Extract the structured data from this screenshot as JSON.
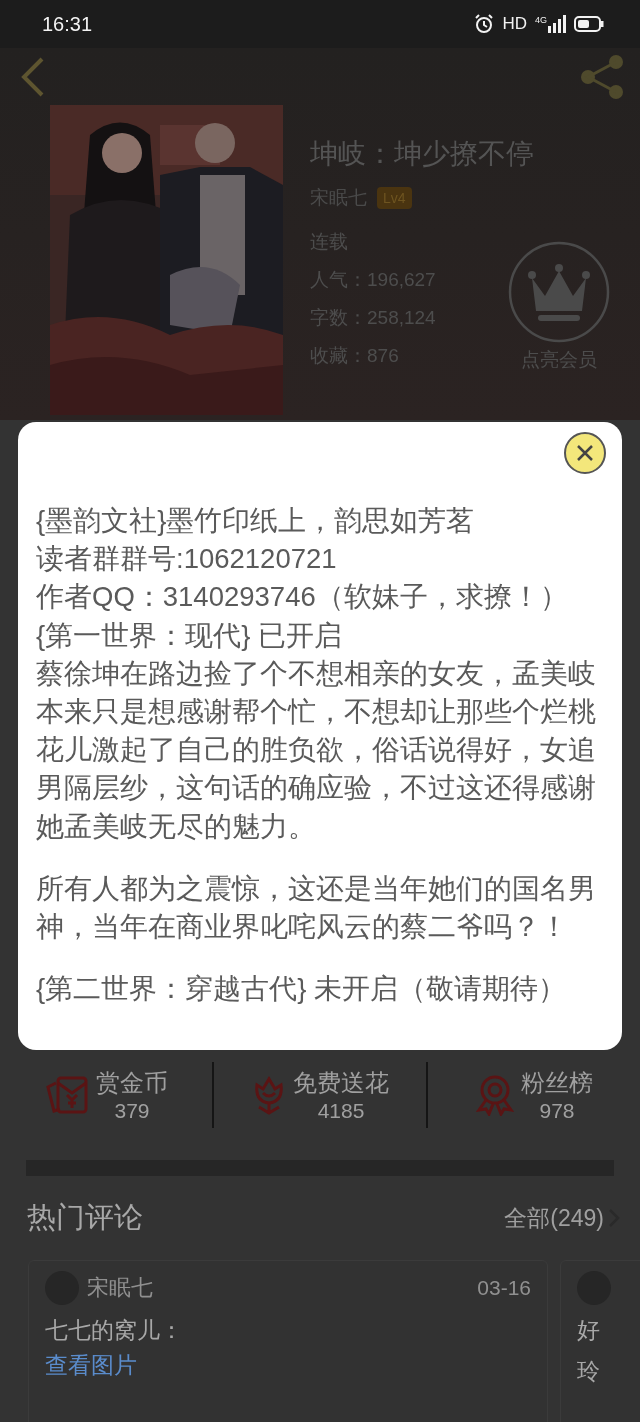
{
  "status_bar": {
    "time": "16:31",
    "network_label": "HD",
    "signal_label": "4G"
  },
  "book": {
    "title": "坤岐：坤少撩不停",
    "author": "宋眠七",
    "author_level": "Lv4",
    "status": "连载",
    "stats": [
      "人气：196,627",
      "字数：258,124",
      "收藏：876"
    ],
    "membership_label": "点亮会员"
  },
  "dialog": {
    "blocks": [
      [
        "{墨韵文社}墨竹印纸上，韵思如芳茗",
        "读者群群号:1062120721",
        "作者QQ：3140293746（软妹子，求撩！）",
        "{第一世界：现代} 已开启",
        "蔡徐坤在路边捡了个不想相亲的女友，孟美岐本来只是想感谢帮个忙，不想却让那些个烂桃花儿激起了自己的胜负欲，俗话说得好，女追男隔层纱，这句话的确应验，不过这还得感谢她孟美岐无尽的魅力。"
      ],
      [
        "所有人都为之震惊，这还是当年她们的国名男神，当年在商业界叱咤风云的蔡二爷吗？！"
      ],
      [
        "{第二世界：穿越古代} 未开启（敬请期待）"
      ]
    ]
  },
  "actions": [
    {
      "kind": "reward",
      "label": "赏金币",
      "count": "379"
    },
    {
      "kind": "flower",
      "label": "免费送花",
      "count": "4185"
    },
    {
      "kind": "fans",
      "label": "粉丝榜",
      "count": "978"
    }
  ],
  "comments_section": {
    "title": "热门评论",
    "all_link": "全部(249)",
    "comments": [
      {
        "author": "宋眠七",
        "date": "03-16",
        "lines": [
          "七七的窝儿："
        ],
        "link": "查看图片"
      },
      {
        "lines": [
          "好",
          "玲"
        ]
      }
    ]
  }
}
